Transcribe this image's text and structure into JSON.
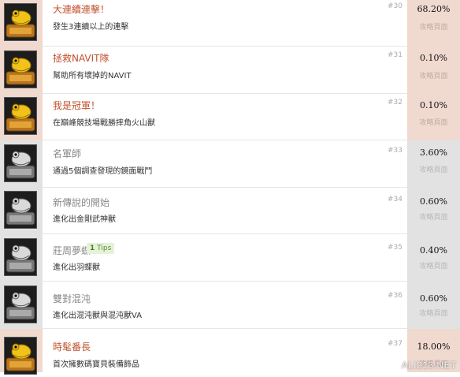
{
  "achievements": [
    {
      "tier": "gold",
      "title": "大連續連擊！",
      "desc": "發生3連續以上的連擊",
      "num": "#30",
      "pct": "68.20%",
      "guide": "攻略頁面"
    },
    {
      "tier": "gold",
      "title": "拯救NAVIT隊",
      "desc": "幫助所有壞掉的NAVIT",
      "num": "#31",
      "pct": "0.10%",
      "guide": "攻略頁面"
    },
    {
      "tier": "gold",
      "title": "我是冠軍！",
      "desc": "在巔峰競技場戰勝摔角火山獸",
      "num": "#32",
      "pct": "0.10%",
      "guide": "攻略頁面"
    },
    {
      "tier": "silver",
      "title": "名軍師",
      "desc": "通過5個調查發現的鏡面戰鬥",
      "num": "#33",
      "pct": "3.60%",
      "guide": "攻略頁面"
    },
    {
      "tier": "silver",
      "title": "新傳說的開始",
      "desc": "進化出金剛武神獸",
      "num": "#34",
      "pct": "0.60%",
      "guide": "攻略頁面"
    },
    {
      "tier": "silver",
      "title": "莊周夢蝶",
      "desc": "進化出羽蝶獸",
      "num": "#35",
      "pct": "0.40%",
      "guide": "攻略頁面",
      "tips": {
        "count": "1",
        "label": "Tips"
      }
    },
    {
      "tier": "silver",
      "title": "雙對混沌",
      "desc": "進化出混沌獸與混沌獸VA",
      "num": "#36",
      "pct": "0.60%",
      "guide": "攻略頁面"
    },
    {
      "tier": "gold",
      "title": "時髦番長",
      "desc": "首次擁數碼寶貝裝備飾品",
      "num": "#37",
      "pct": "18.00%",
      "guide": "攻略頁面"
    }
  ],
  "watermark": "ALI213.NET"
}
